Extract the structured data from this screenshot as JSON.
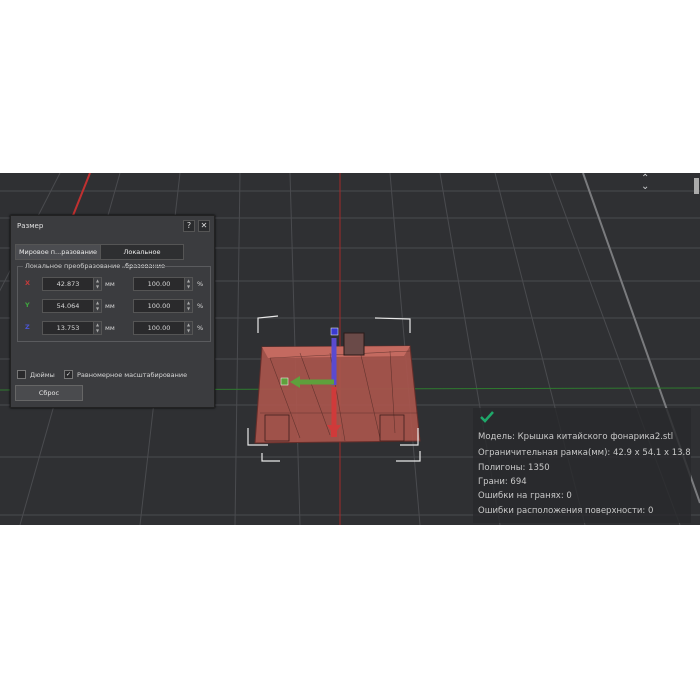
{
  "panel": {
    "title": "Размер",
    "help_label": "?",
    "close_label": "✕",
    "tabs": [
      {
        "label": "Мировое п...разование",
        "active": false
      },
      {
        "label": "Локальное ...бразование",
        "active": true
      }
    ],
    "group_label": "Локальное преобразование",
    "rows": [
      {
        "axis": "X",
        "axis_color": "#c43a3a",
        "value": "42.873",
        "unit": "мм",
        "percent": "100.00",
        "percent_unit": "%"
      },
      {
        "axis": "Y",
        "axis_color": "#3fa63f",
        "value": "54.064",
        "unit": "мм",
        "percent": "100.00",
        "percent_unit": "%"
      },
      {
        "axis": "Z",
        "axis_color": "#4a55d6",
        "value": "13.753",
        "unit": "мм",
        "percent": "100.00",
        "percent_unit": "%"
      }
    ],
    "inches_label": "Дюймы",
    "inches_checked": false,
    "uniform_label": "Равномерное масштабирование",
    "uniform_checked": true,
    "reset_label": "Сброс"
  },
  "info": {
    "status_icon": "check-icon",
    "status_color": "#1fa86a",
    "lines": [
      "Модель: Крышка китайского фонарика2.stl",
      "Ограничительная рамка(мм): 42.9 x 54.1 x 13.8",
      "Полигоны: 1350",
      "Грани: 694",
      "Ошибки на гранях: 0",
      "Ошибки расположения поверхности: 0"
    ]
  },
  "colors": {
    "viewport_bg": "#2f3033",
    "model_fill": "#b05a52",
    "axis_red": "#d23c3c",
    "axis_green": "#58a33c",
    "axis_blue": "#4a4ad8"
  }
}
